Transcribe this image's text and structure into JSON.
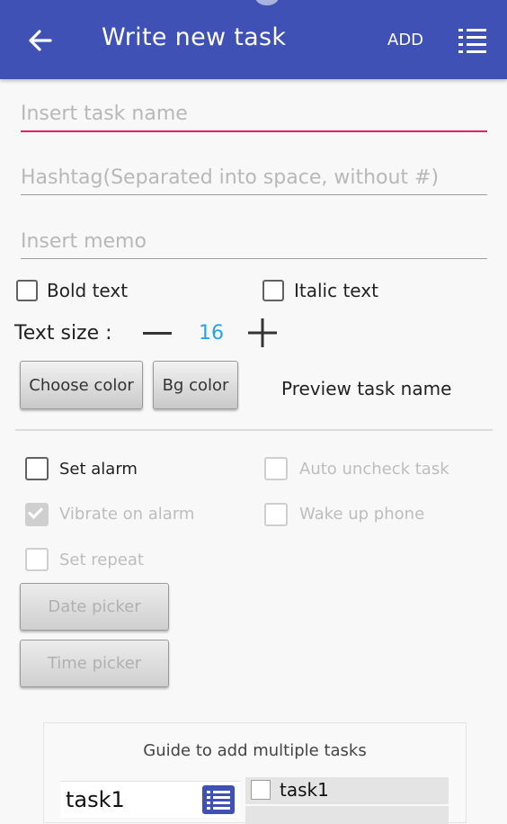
{
  "app_bar": {
    "title": "Write new task",
    "add_label": "ADD",
    "back_icon": "arrow-back-icon",
    "list_icon": "list-icon",
    "background": "#3f51b5"
  },
  "form": {
    "task_name_placeholder": "Insert task name",
    "hashtag_placeholder": "Hashtag(Separated into space, without #)",
    "memo_placeholder": "Insert memo",
    "bold_label": "Bold text",
    "italic_label": "Italic text",
    "text_size_label": "Text size :",
    "text_size_value": "16",
    "text_size_value_color": "#29a3e6",
    "choose_color_label": "Choose color",
    "bg_color_label": "Bg color",
    "preview_label": "Preview task name",
    "accent_color": "#e91e63"
  },
  "alarm": {
    "set_alarm_label": "Set alarm",
    "auto_uncheck_label": "Auto uncheck task",
    "vibrate_label": "Vibrate on alarm",
    "vibrate_checked": true,
    "wake_up_label": "Wake up phone",
    "set_repeat_label": "Set repeat",
    "date_picker_label": "Date picker",
    "time_picker_label": "Time picker"
  },
  "guide": {
    "title": "Guide to add multiple tasks",
    "input_text": "task1",
    "row_text": "task1"
  }
}
